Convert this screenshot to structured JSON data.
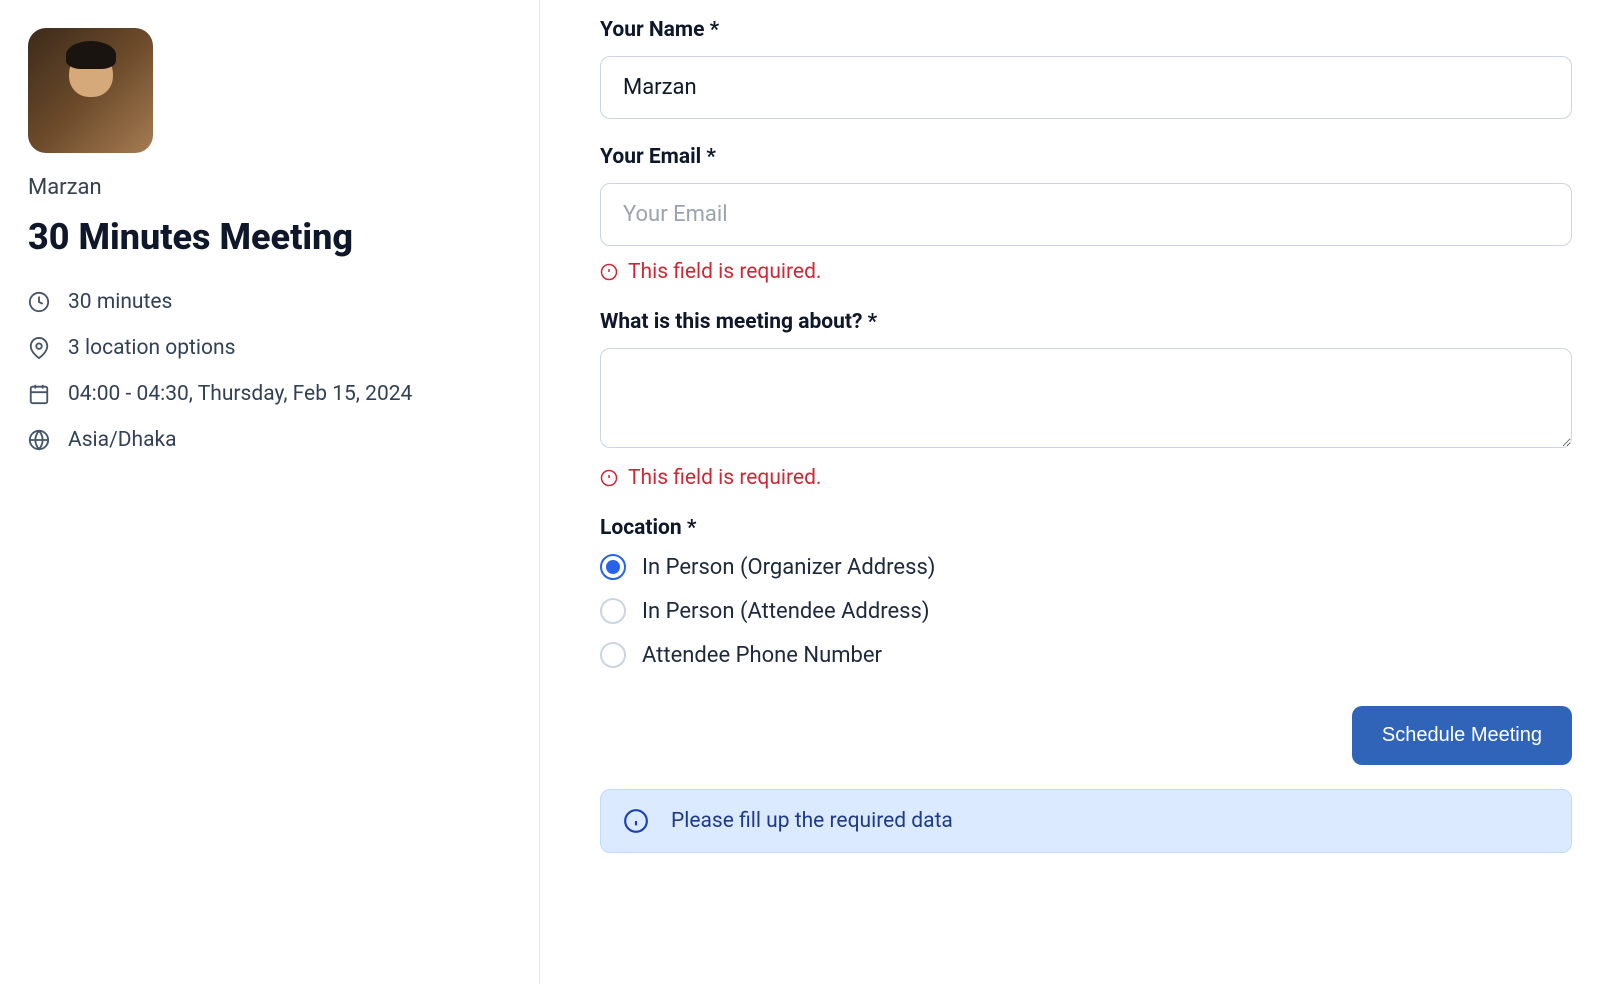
{
  "sidebar": {
    "organizer_name": "Marzan",
    "meeting_title": "30 Minutes Meeting",
    "duration": "30 minutes",
    "location_options": "3 location options",
    "datetime": "04:00 - 04:30, Thursday, Feb 15, 2024",
    "timezone": "Asia/Dhaka"
  },
  "form": {
    "name": {
      "label": "Your Name *",
      "value": "Marzan"
    },
    "email": {
      "label": "Your Email *",
      "value": "",
      "placeholder": "Your Email",
      "error": "This field is required."
    },
    "about": {
      "label": "What is this meeting about? *",
      "value": "",
      "error": "This field is required."
    },
    "location": {
      "label": "Location *",
      "options": [
        {
          "label": "In Person (Organizer Address)",
          "selected": true
        },
        {
          "label": "In Person (Attendee Address)",
          "selected": false
        },
        {
          "label": "Attendee Phone Number",
          "selected": false
        }
      ]
    },
    "submit_label": "Schedule Meeting"
  },
  "alert": {
    "message": "Please fill up the required data"
  }
}
